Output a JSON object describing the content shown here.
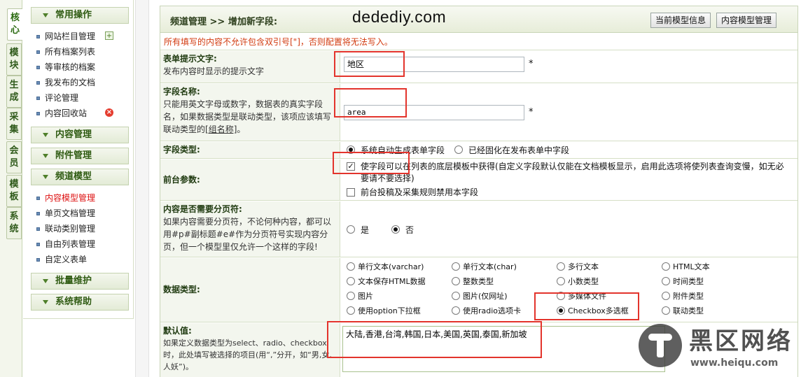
{
  "vtabs": [
    "核心",
    "模块",
    "生成",
    "采集",
    "会员",
    "模板",
    "系统"
  ],
  "menu": {
    "sections": [
      {
        "title": "常用操作"
      },
      {
        "title": "内容管理"
      },
      {
        "title": "附件管理"
      },
      {
        "title": "频道模型"
      },
      {
        "title": "批量维护"
      },
      {
        "title": "系统帮助"
      }
    ],
    "common_items": [
      "网站栏目管理",
      "所有档案列表",
      "等审核的档案",
      "我发布的文档",
      "评论管理",
      "内容回收站"
    ],
    "channel_items": [
      "内容模型管理",
      "单页文档管理",
      "联动类别管理",
      "自由列表管理",
      "自定义表单"
    ],
    "add_icon_glyph": "+",
    "del_icon_glyph": "×"
  },
  "header": {
    "breadcrumb": "频道管理 >> 增加新字段:",
    "watermark": "dedediy.com",
    "btn_model_info": "当前模型信息",
    "btn_model_manage": "内容模型管理"
  },
  "notice": "所有填写的内容不允许包含双引号[\"]，否则配置将无法写入。",
  "form": {
    "prompt": {
      "label": "表单提示文字:",
      "desc": "发布内容时显示的提示文字",
      "value": "地区",
      "required": "*"
    },
    "fieldname": {
      "label": "字段名称:",
      "desc_before": "只能用英文字母或数字，数据表的真实字段名，如果数据类型是联动类型，该项应该填写联动类型的",
      "desc_link": "[组名称]",
      "desc_after": "。",
      "value": "area",
      "required": "*"
    },
    "fieldtype": {
      "label": "字段类型:",
      "options": [
        "系统自动生成表单字段",
        "已经固化在发布表单中字段"
      ],
      "selected": 0
    },
    "frontend": {
      "label": "前台参数:",
      "opt1": "使字段可以在列表的底层模板中获得(自定义字段默认仅能在文档模板显示，启用此选项将使列表查询变慢，如无必要请不要选择)",
      "opt1_checked": true,
      "opt2": "前台投稿及采集规则禁用本字段",
      "opt2_checked": false
    },
    "pagebreak": {
      "label": "内容是否需要分页符:",
      "desc": "如果内容需要分页符，不论何种内容，都可以用#p#副标题#e#作为分页符号实现内容分页，但一个模型里仅允许一个这样的字段!",
      "options": [
        "是",
        "否"
      ],
      "selected": 1
    },
    "datatype": {
      "label": "数据类型:",
      "options": [
        "单行文本(varchar)",
        "单行文本(char)",
        "多行文本",
        "HTML文本",
        "文本保存HTML数据",
        "整数类型",
        "小数类型",
        "时间类型",
        "图片",
        "图片(仅网址)",
        "多媒体文件",
        "附件类型",
        "使用option下拉框",
        "使用radio选项卡",
        "Checkbox多选框",
        "联动类型"
      ],
      "selected": 14
    },
    "default": {
      "label": "默认值:",
      "desc": "如果定义数据类型为select、radio、checkbox时，此处填写被选择的项目(用“,”分开，如“男,女,人妖”)。",
      "value": "大陆,香港,台湾,韩国,日本,美国,英国,泰国,新加坡"
    }
  },
  "site_watermark": {
    "title": "黑区网络",
    "url": "www.heiqu.com"
  },
  "colors": {
    "accent_green": "#2f5b12",
    "notice_red": "#d23a0f",
    "highlight_red": "#e3342c"
  }
}
